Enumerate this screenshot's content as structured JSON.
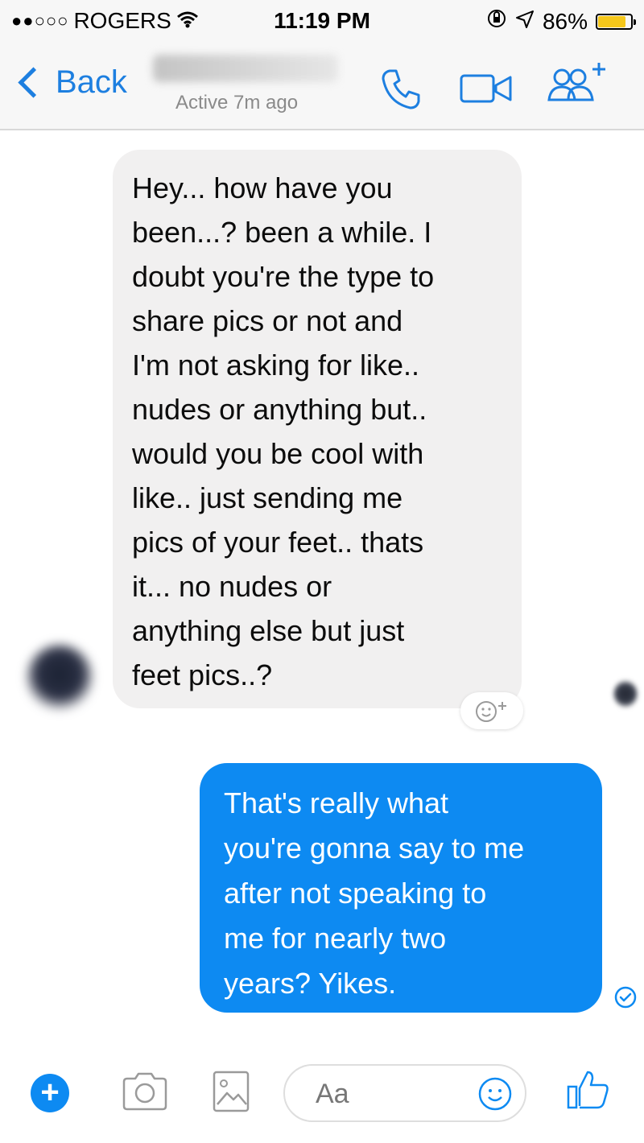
{
  "status_bar": {
    "signal": "●●○○○",
    "carrier": "ROGERS",
    "time": "11:19 PM",
    "battery": "86%",
    "battery_level": 0.86,
    "battery_color": "#f5c71a"
  },
  "header": {
    "back_label": "Back",
    "status": "Active 7m ago",
    "icons": [
      "phone-icon",
      "video-icon",
      "add-people-icon"
    ]
  },
  "messages": {
    "incoming": {
      "lines": [
        "Hey...  how have you",
        "been...? been a while.  I",
        "doubt you're the type to",
        "share pics or not and",
        "I'm not asking for like..",
        "nudes or anything but..",
        "would you be cool with",
        "like..  just sending me",
        "pics of your feet..  thats",
        "it... no nudes or",
        "anything else but just",
        "feet pics..?"
      ],
      "bubble_color": "#f1f0f0"
    },
    "outgoing": {
      "lines": [
        "That's really what",
        "you're gonna say to me",
        "after not speaking to",
        "me for nearly two",
        "years? Yikes."
      ],
      "bubble_color": "#0d8af2"
    }
  },
  "composer": {
    "placeholder": "Aa",
    "icons": [
      "plus-icon",
      "camera-icon",
      "gallery-icon",
      "emoji-icon",
      "thumbs-up-icon"
    ],
    "accent": "#0d8af2"
  }
}
